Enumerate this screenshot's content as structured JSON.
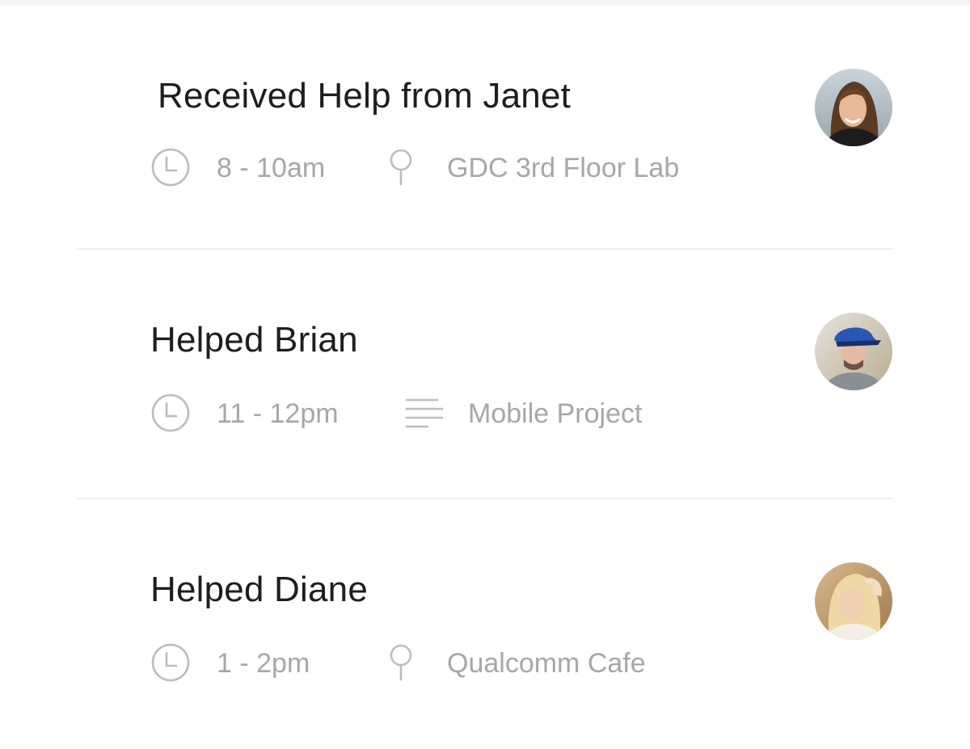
{
  "feed": {
    "entries": [
      {
        "title": "Received Help from Janet",
        "time": "8 - 10am",
        "detail_icon": "location-pin-icon",
        "detail": "GDC 3rd Floor Lab",
        "avatar_of": "Janet"
      },
      {
        "title": "Helped Brian",
        "time": "11 - 12pm",
        "detail_icon": "lines-icon",
        "detail": "Mobile Project",
        "avatar_of": "Brian"
      },
      {
        "title": "Helped Diane",
        "time": "1 - 2pm",
        "detail_icon": "location-pin-icon",
        "detail": "Qualcomm Cafe",
        "avatar_of": "Diane"
      }
    ]
  },
  "colors": {
    "title": "#1d1d22",
    "meta": "#a7a7aa",
    "icon": "#bdbdc0",
    "divider": "#efefef",
    "top_strip": "#f4f4f4"
  }
}
